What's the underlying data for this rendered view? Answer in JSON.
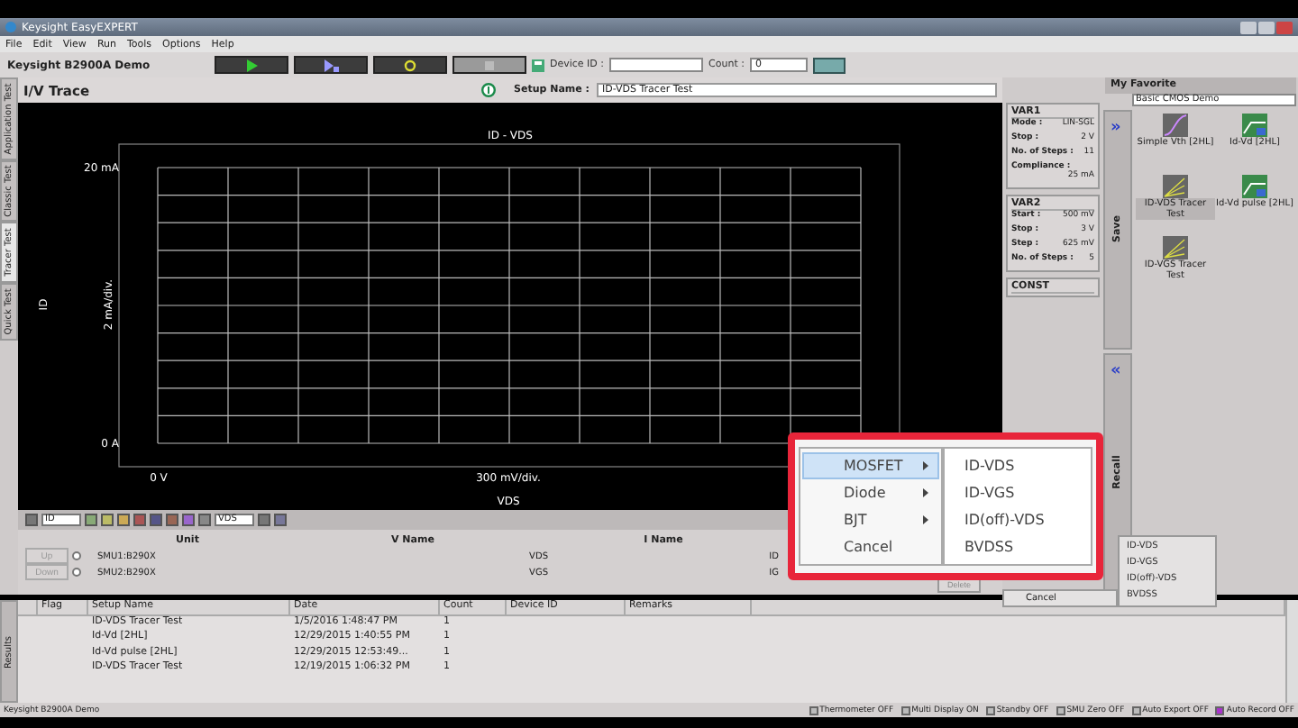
{
  "window": {
    "title": "Keysight EasyEXPERT"
  },
  "menu": [
    "File",
    "Edit",
    "View",
    "Run",
    "Tools",
    "Options",
    "Help"
  ],
  "toolbar": {
    "instrument": "Keysight B2900A Demo",
    "buttons": [
      {
        "kind": "run",
        "disabled": false
      },
      {
        "kind": "run-multi",
        "disabled": false
      },
      {
        "kind": "repeat",
        "disabled": false
      },
      {
        "kind": "stop",
        "disabled": true
      }
    ],
    "device_id_label": "Device ID :",
    "count_label": "Count :",
    "count_value": "0"
  },
  "side_tabs": [
    {
      "label": "Application Test",
      "selected": false
    },
    {
      "label": "Classic Test",
      "selected": false
    },
    {
      "label": "Tracer Test",
      "selected": true
    },
    {
      "label": "Quick Test",
      "selected": false
    }
  ],
  "panel_title": "I/V Trace",
  "setup_name_label": "Setup Name :",
  "setup_name": "ID-VDS Tracer Test",
  "graph": {
    "title": "ID - VDS",
    "y_axis": "ID",
    "y_max": "20 mA",
    "y_min": "0 A",
    "y_div": "2 mA/div.",
    "x_min": "0 V",
    "x_div": "300 mV/div.",
    "x_axis": "VDS"
  },
  "graph_toolbar": {
    "y_select": "ID",
    "x_select": "VDS"
  },
  "smu_table": {
    "columns": [
      "Unit",
      "V Name",
      "I Name"
    ],
    "rows": [
      {
        "unit": "SMU1:B290X",
        "v_name": "VDS",
        "i_name": "ID",
        "selected": false
      },
      {
        "unit": "SMU2:B290X",
        "v_name": "VGS",
        "i_name": "IG",
        "selected": false
      }
    ],
    "buttons": [
      {
        "label": "Up",
        "disabled": true
      },
      {
        "label": "Down",
        "disabled": true
      }
    ]
  },
  "var_panels": [
    {
      "title": "VAR1",
      "fields": [
        {
          "label": "Mode :",
          "value": "LIN-SGL"
        },
        {
          "label": "Stop :",
          "value": "2 V"
        },
        {
          "label": "No. of Steps :",
          "value": "11"
        },
        {
          "label": "Compliance :",
          "value": "25 mA"
        }
      ]
    },
    {
      "title": "VAR2",
      "fields": [
        {
          "label": "Start :",
          "value": "500 mV"
        },
        {
          "label": "Stop :",
          "value": "3 V"
        },
        {
          "label": "Step :",
          "value": "625 mV"
        },
        {
          "label": "No. of Steps :",
          "value": "5"
        }
      ]
    },
    {
      "title": "CONST"
    }
  ],
  "favorites": {
    "title": "My Favorite",
    "group": "Basic CMOS Demo",
    "save_label": "Save",
    "save_glyph": "»",
    "recall_label": "Recall",
    "recall_glyph": "«",
    "items": [
      {
        "label": "Simple Vth [2HL]",
        "kind": "curve",
        "selected": false
      },
      {
        "label": "Id-Vd [2HL]",
        "kind": "pulse",
        "selected": false
      },
      {
        "label": "ID-VDS Tracer Test",
        "kind": "tracer",
        "selected": true
      },
      {
        "label": "Id-Vd pulse [2HL]",
        "kind": "pulse",
        "selected": false
      },
      {
        "label": "ID-VGS Tracer Test",
        "kind": "tracer",
        "selected": false
      }
    ]
  },
  "popup_menu": {
    "items": [
      {
        "label": "MOSFET",
        "submenu": true,
        "selected": true
      },
      {
        "label": "Diode",
        "submenu": true,
        "selected": false
      },
      {
        "label": "BJT",
        "submenu": true,
        "selected": false
      },
      {
        "label": "Cancel",
        "submenu": false,
        "selected": false
      }
    ],
    "submenu": [
      "ID-VDS",
      "ID-VGS",
      "ID(off)-VDS",
      "BVDSS"
    ]
  },
  "background_menu": {
    "items": [
      "ID-VDS",
      "ID-VGS",
      "ID(off)-VDS",
      "BVDSS"
    ],
    "cancel": "Cancel",
    "delete": "Delete"
  },
  "results": {
    "tab": "Results",
    "columns": [
      "Flag",
      "Setup Name",
      "Date",
      "Count",
      "Device ID",
      "Remarks"
    ],
    "rows": [
      [
        "",
        "ID-VDS Tracer Test",
        "1/5/2016 1:48:47 PM",
        "1",
        "",
        ""
      ],
      [
        "",
        "Id-Vd [2HL]",
        "12/29/2015 1:40:55 PM",
        "1",
        "",
        ""
      ],
      [
        "",
        "Id-Vd pulse [2HL]",
        "12/29/2015 12:53:49...",
        "1",
        "",
        ""
      ],
      [
        "",
        "ID-VDS Tracer Test",
        "12/19/2015 1:06:32 PM",
        "1",
        "",
        ""
      ]
    ]
  },
  "status_bar": {
    "left": "Keysight B2900A Demo",
    "indicators": [
      "Thermometer OFF",
      "Multi Display ON",
      "Standby OFF",
      "SMU Zero OFF",
      "Auto Export OFF",
      "Auto Record OFF"
    ]
  }
}
